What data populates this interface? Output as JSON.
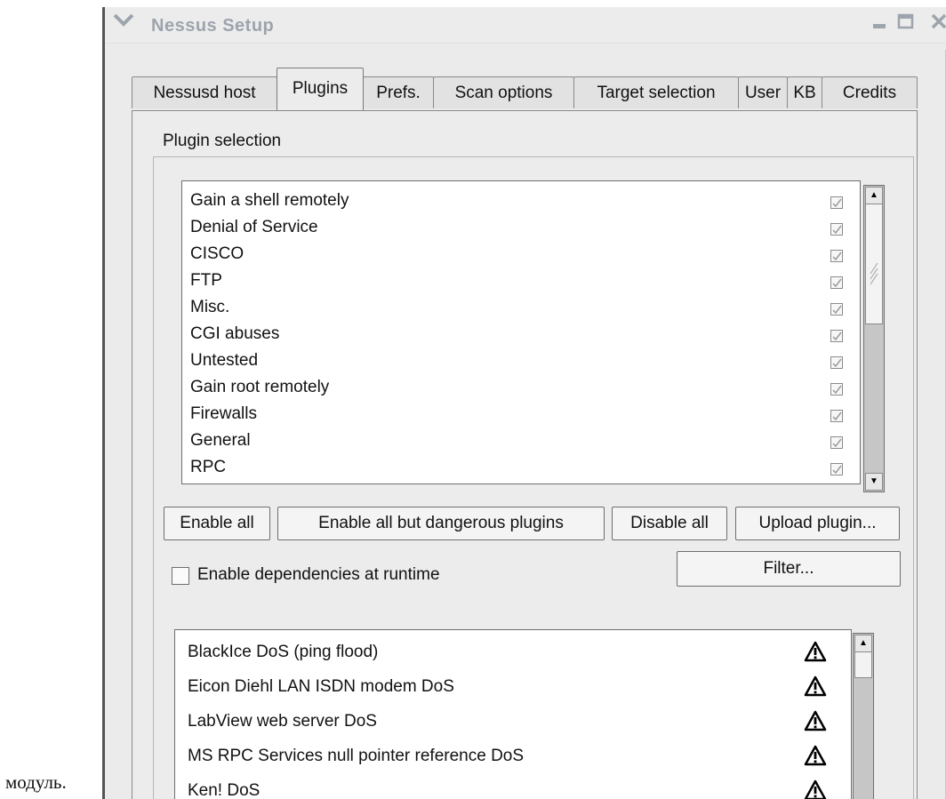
{
  "caption": "модуль.",
  "window": {
    "title": "Nessus Setup",
    "menu_icon": "chevron-down-icon",
    "minimize_icon": "minimize-icon",
    "maximize_icon": "maximize-icon",
    "close_icon": "close-icon"
  },
  "tabs": [
    {
      "label": "Nessusd host",
      "active": false
    },
    {
      "label": "Plugins",
      "active": true
    },
    {
      "label": "Prefs.",
      "active": false
    },
    {
      "label": "Scan options",
      "active": false
    },
    {
      "label": "Target selection",
      "active": false
    },
    {
      "label": "User",
      "active": false
    },
    {
      "label": "KB",
      "active": false
    },
    {
      "label": "Credits",
      "active": false
    }
  ],
  "plugin_selection": {
    "frame_label": "Plugin selection",
    "families": [
      {
        "name": "Gain a shell remotely",
        "checked": true
      },
      {
        "name": "Denial of Service",
        "checked": true
      },
      {
        "name": "CISCO",
        "checked": true
      },
      {
        "name": "FTP",
        "checked": true
      },
      {
        "name": "Misc.",
        "checked": true
      },
      {
        "name": "CGI abuses",
        "checked": true
      },
      {
        "name": "Untested",
        "checked": true
      },
      {
        "name": "Gain root remotely",
        "checked": true
      },
      {
        "name": "Firewalls",
        "checked": true
      },
      {
        "name": "General",
        "checked": true
      },
      {
        "name": "RPC",
        "checked": true
      }
    ],
    "buttons": {
      "enable_all": "Enable all",
      "enable_safe": "Enable all but dangerous plugins",
      "disable_all": "Disable all",
      "upload": "Upload plugin..."
    },
    "dependencies": {
      "label": "Enable dependencies at runtime",
      "checked": false
    },
    "filter_label": "Filter...",
    "plugins": [
      {
        "name": "BlackIce DoS (ping flood)",
        "icon": "warning-icon"
      },
      {
        "name": "Eicon Diehl LAN ISDN modem DoS",
        "icon": "warning-icon"
      },
      {
        "name": "LabView web server DoS",
        "icon": "warning-icon"
      },
      {
        "name": "MS RPC Services null pointer reference DoS",
        "icon": "warning-icon"
      },
      {
        "name": "Ken! DoS",
        "icon": "warning-icon"
      }
    ]
  },
  "colors": {
    "window_bg": "#ececec",
    "title_text": "#9ea4ad",
    "list_bg": "#ffffff"
  }
}
